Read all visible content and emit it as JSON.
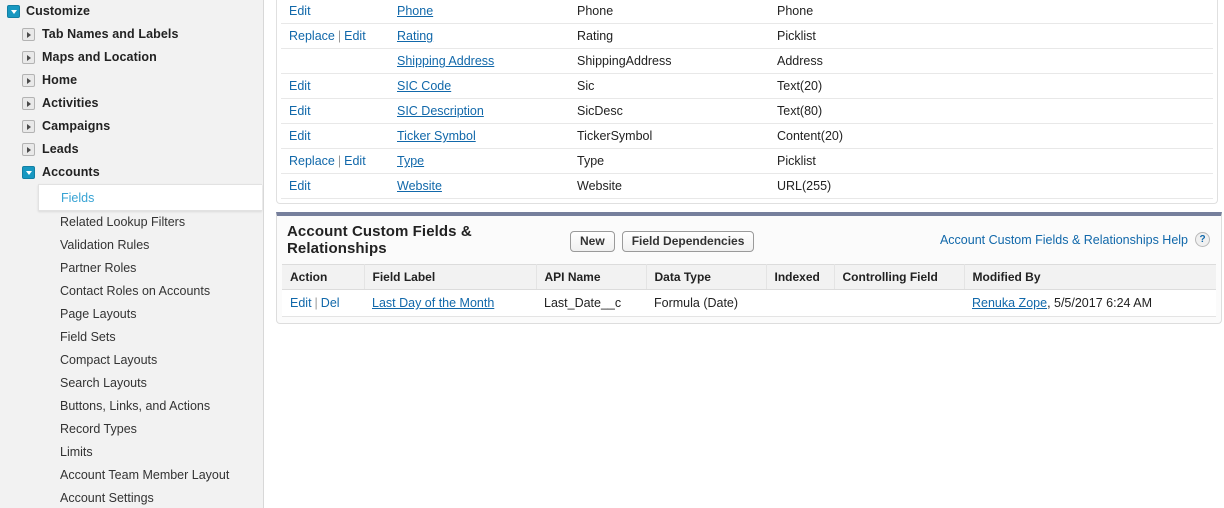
{
  "sidebar": {
    "root": {
      "label": "Customize",
      "expander": "chevron-down-icon"
    },
    "groups": [
      {
        "label": "Tab Names and Labels",
        "expander": "chevron-right-icon"
      },
      {
        "label": "Maps and Location",
        "expander": "chevron-right-icon"
      },
      {
        "label": "Home",
        "expander": "chevron-right-icon"
      },
      {
        "label": "Activities",
        "expander": "chevron-right-icon"
      },
      {
        "label": "Campaigns",
        "expander": "chevron-right-icon"
      },
      {
        "label": "Leads",
        "expander": "chevron-right-icon"
      },
      {
        "label": "Accounts",
        "expander": "chevron-down-icon"
      }
    ],
    "items": [
      {
        "label": "Fields",
        "selected": true
      },
      {
        "label": "Related Lookup Filters",
        "selected": false
      },
      {
        "label": "Validation Rules",
        "selected": false
      },
      {
        "label": "Partner Roles",
        "selected": false
      },
      {
        "label": "Contact Roles on Accounts",
        "selected": false
      },
      {
        "label": "Page Layouts",
        "selected": false
      },
      {
        "label": "Field Sets",
        "selected": false
      },
      {
        "label": "Compact Layouts",
        "selected": false
      },
      {
        "label": "Search Layouts",
        "selected": false
      },
      {
        "label": "Buttons, Links, and Actions",
        "selected": false
      },
      {
        "label": "Record Types",
        "selected": false
      },
      {
        "label": "Limits",
        "selected": false
      },
      {
        "label": "Account Team Member Layout",
        "selected": false
      },
      {
        "label": "Account Settings",
        "selected": false
      }
    ]
  },
  "standard_fields": {
    "actions": {
      "edit": "Edit",
      "replace": "Replace",
      "separator": "|"
    },
    "rows": [
      {
        "actions": [
          "Edit"
        ],
        "label": "Phone",
        "api": "Phone",
        "type": "Phone"
      },
      {
        "actions": [
          "Replace",
          "Edit"
        ],
        "label": "Rating",
        "api": "Rating",
        "type": "Picklist"
      },
      {
        "actions": [],
        "label": "Shipping Address",
        "api": "ShippingAddress",
        "type": "Address"
      },
      {
        "actions": [
          "Edit"
        ],
        "label": "SIC Code",
        "api": "Sic",
        "type": "Text(20)"
      },
      {
        "actions": [
          "Edit"
        ],
        "label": "SIC Description",
        "api": "SicDesc",
        "type": "Text(80)"
      },
      {
        "actions": [
          "Edit"
        ],
        "label": "Ticker Symbol",
        "api": "TickerSymbol",
        "type": "Content(20)"
      },
      {
        "actions": [
          "Replace",
          "Edit"
        ],
        "label": "Type",
        "api": "Type",
        "type": "Picklist"
      },
      {
        "actions": [
          "Edit"
        ],
        "label": "Website",
        "api": "Website",
        "type": "URL(255)"
      }
    ]
  },
  "custom_section": {
    "title": "Account Custom Fields & Relationships",
    "buttons": [
      {
        "label": "New",
        "name": "new-button"
      },
      {
        "label": "Field Dependencies",
        "name": "field-dependencies-button"
      }
    ],
    "help": {
      "label": "Account Custom Fields & Relationships Help",
      "icon": "question-mark-icon",
      "glyph": "?"
    },
    "columns": [
      "Action",
      "Field Label",
      "API Name",
      "Data Type",
      "Indexed",
      "Controlling Field",
      "Modified By"
    ],
    "rows": [
      {
        "action_edit": "Edit",
        "action_sep": "|",
        "action_del": "Del",
        "label": "Last Day of the Month",
        "api": "Last_Date__c",
        "type": "Formula (Date)",
        "indexed": "",
        "controlling": "",
        "modified_by_user": "Renuka Zope",
        "modified_by_date": ", 5/5/2017 6:24 AM"
      }
    ]
  },
  "colors": {
    "accent_teal": "#1798c1",
    "link_blue": "#1168aa",
    "selected_link": "#37a3d4",
    "panel_bar": "#767f9c",
    "sidebar_bg": "#f2f2f2"
  }
}
